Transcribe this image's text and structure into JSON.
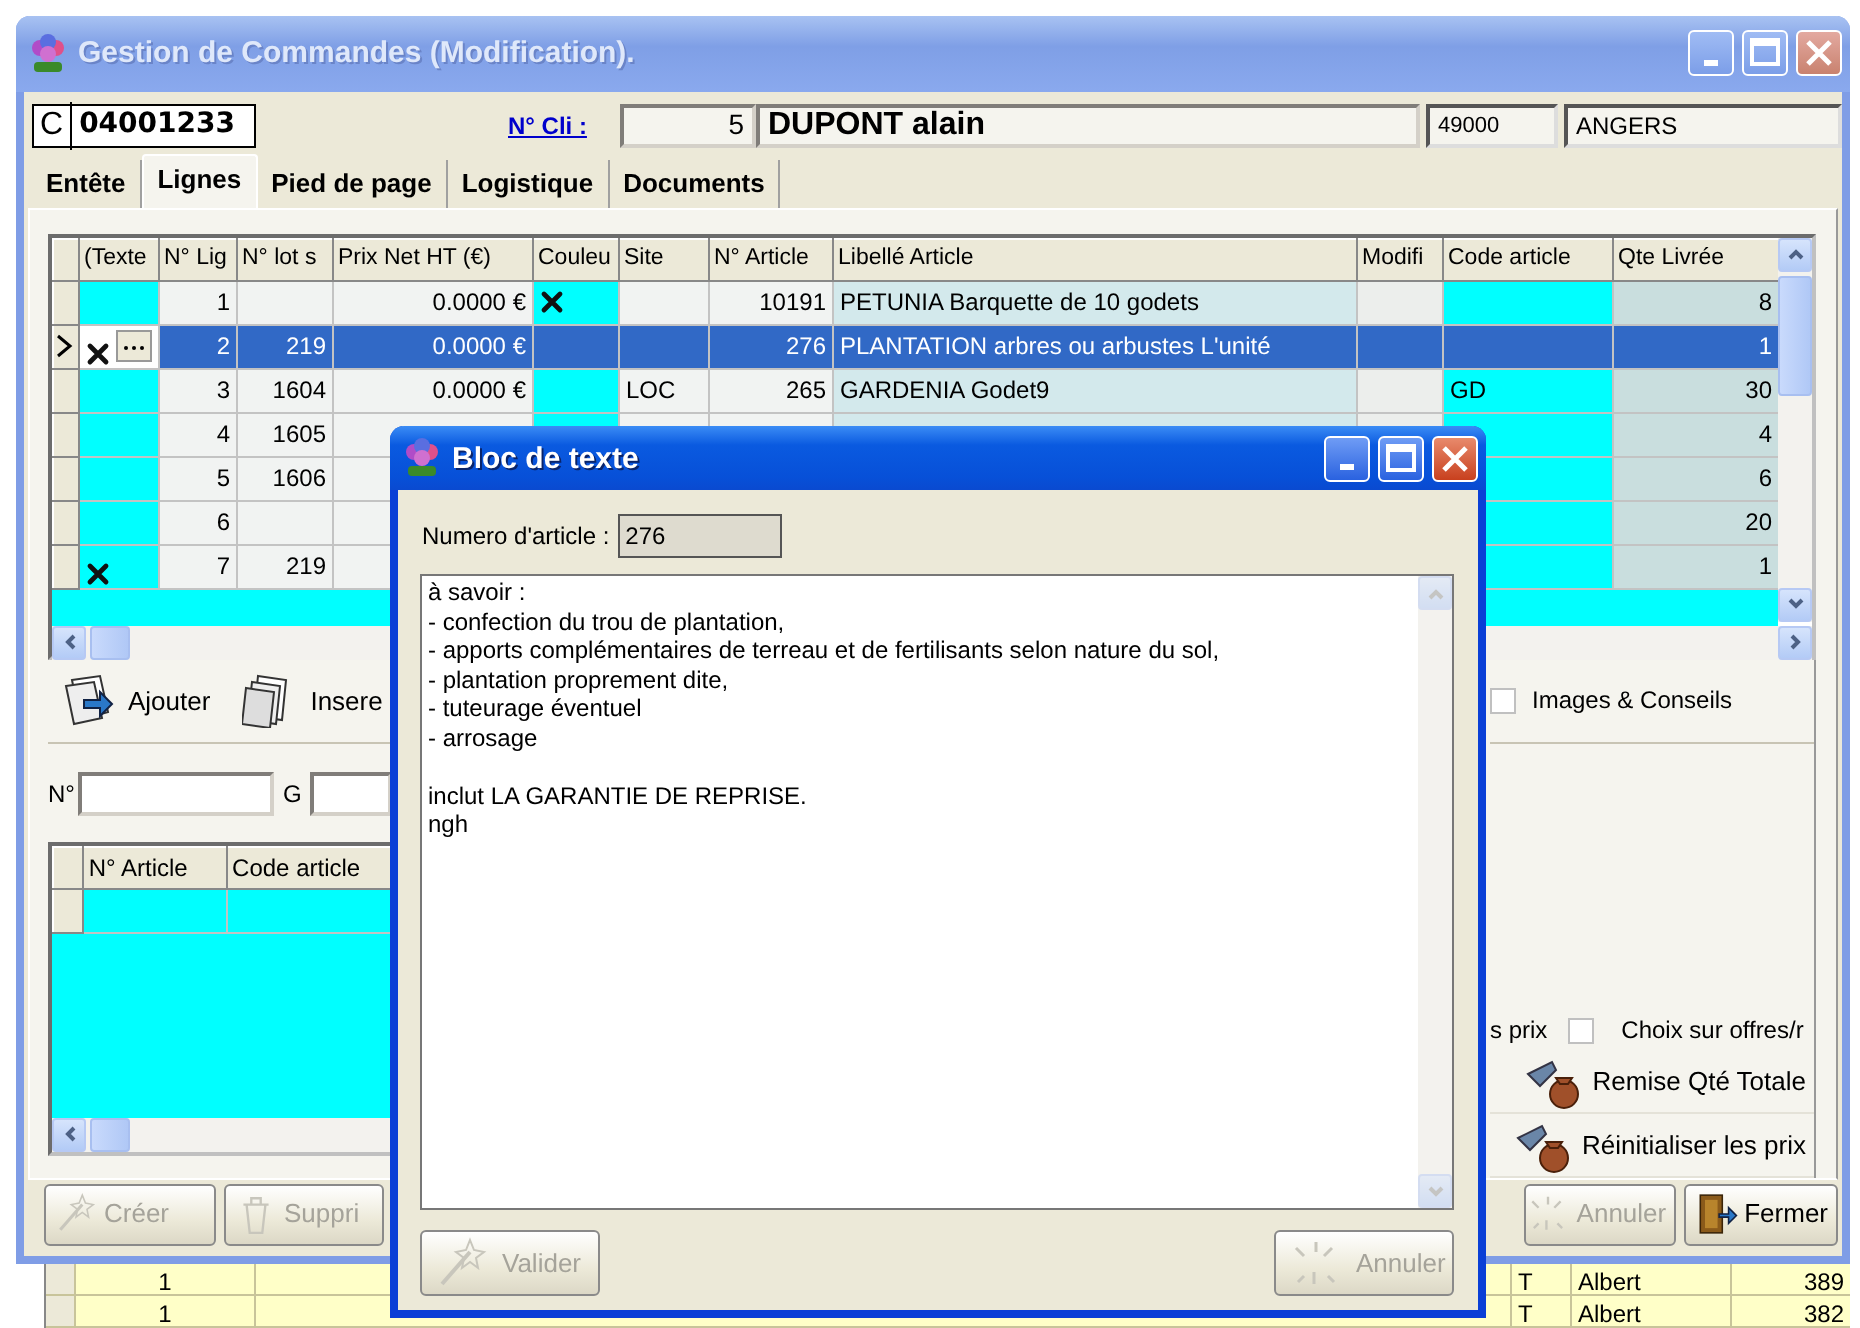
{
  "window": {
    "title": "Gestion de Commandes (Modification).",
    "active": false
  },
  "header": {
    "order_prefix": "C",
    "order_number": "04001233",
    "client_label": "N° Cli :",
    "client_number": "5",
    "client_name": "DUPONT alain",
    "postal_code": "49000",
    "city": "ANGERS"
  },
  "tabs": [
    {
      "label": "Entête",
      "selected": false
    },
    {
      "label": "Lignes",
      "selected": true
    },
    {
      "label": "Pied de page",
      "selected": false
    },
    {
      "label": "Logistique",
      "selected": false
    },
    {
      "label": "Documents",
      "selected": false
    }
  ],
  "lines_grid": {
    "columns": [
      "(Texte",
      "N° Lig",
      "N° lot s",
      "Prix Net HT (€)",
      "Couleu",
      "Site",
      "N° Article",
      "Libellé Article",
      "Modifi",
      "Code article",
      "Qte Livrée"
    ],
    "rows": [
      {
        "selected": false,
        "text_marked": false,
        "color_marked": true,
        "editing": false,
        "line": "1",
        "price": "0.0000 €",
        "article": "10191",
        "label": "PETUNIA Barquette de 10 godets",
        "qty": "8"
      },
      {
        "selected": true,
        "text_marked": true,
        "color_marked": false,
        "editing": true,
        "line": "2",
        "lot": "219",
        "price": "0.0000 €",
        "article": "276",
        "label": "PLANTATION arbres ou arbustes L'unité",
        "qty": "1"
      },
      {
        "selected": false,
        "text_marked": false,
        "color_marked": false,
        "editing": false,
        "line": "3",
        "lot": "1604",
        "price": "0.0000 €",
        "site": "LOC",
        "article": "265",
        "label": "GARDENIA Godet9",
        "code": "GD",
        "qty": "30"
      },
      {
        "selected": false,
        "text_marked": false,
        "color_marked": false,
        "editing": false,
        "line": "4",
        "lot": "1605",
        "qty": "4"
      },
      {
        "selected": false,
        "text_marked": false,
        "color_marked": false,
        "editing": false,
        "line": "5",
        "lot": "1606",
        "qty": "6"
      },
      {
        "selected": false,
        "text_marked": false,
        "color_marked": false,
        "editing": false,
        "line": "6",
        "qty": "20"
      },
      {
        "selected": false,
        "text_marked": true,
        "color_marked": false,
        "editing": false,
        "line": "7",
        "lot": "219",
        "qty": "1"
      }
    ]
  },
  "actions": [
    {
      "label": "Ajouter",
      "kind": "add"
    },
    {
      "label": "Insere",
      "kind": "insert"
    }
  ],
  "images_option": {
    "label": "Images & Conseils",
    "checked": false
  },
  "search": {
    "number_label": "N°",
    "group_label": "G"
  },
  "detail_grid": {
    "columns": [
      "N° Article",
      "Code article"
    ]
  },
  "price_option": {
    "label": "s prix",
    "checked": false
  },
  "offers_label": "Choix sur offres/r",
  "side_buttons": [
    {
      "label": "Remise Qté Totale"
    },
    {
      "label": "Réinitialiser les prix"
    }
  ],
  "toolbar": [
    {
      "label": "Créer",
      "kind": "create",
      "disabled": true
    },
    {
      "label": "Suppri",
      "kind": "delete",
      "disabled": true
    },
    {
      "label": "Annuler",
      "kind": "cancel",
      "disabled": true
    },
    {
      "label": "Fermer",
      "kind": "close",
      "disabled": false
    }
  ],
  "dialog": {
    "title": "Bloc de texte",
    "active": true,
    "article_label": "Numero d'article :",
    "article_number": "276",
    "text": "à savoir :\n- confection du trou de plantation,\n- apports complémentaires de terreau et de fertilisants selon nature du sol,\n- plantation proprement dite,\n- tuteurage éventuel\n- arrosage\n\ninclut LA GARANTIE DE REPRISE.\nngh",
    "buttons": [
      {
        "label": "Valider",
        "kind": "confirm",
        "disabled": true
      },
      {
        "label": "Annuler",
        "kind": "cancel",
        "disabled": true
      }
    ]
  },
  "background_rows": [
    {
      "line": "1",
      "code": "T",
      "name": "Albert",
      "amount": "389"
    },
    {
      "line": "1",
      "code": "T",
      "name": "Albert",
      "amount": "382"
    }
  ]
}
